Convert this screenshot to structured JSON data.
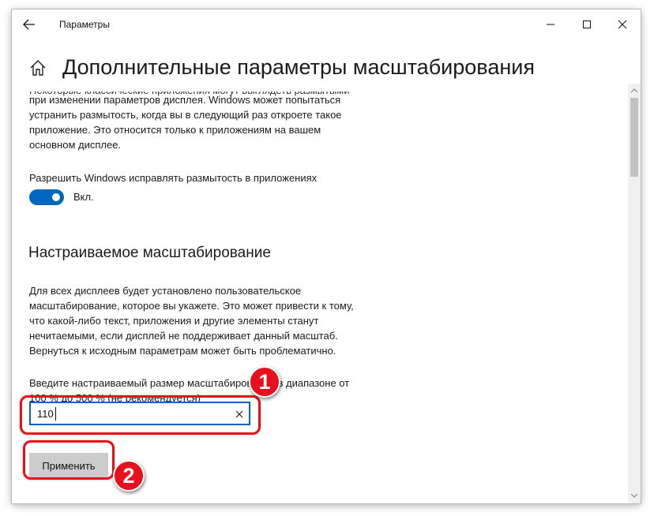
{
  "window": {
    "title": "Параметры",
    "back_icon": "arrow-left-icon",
    "controls": [
      "minimize-icon",
      "maximize-icon",
      "close-icon"
    ]
  },
  "page": {
    "home_icon": "home-icon",
    "title": "Дополнительные параметры масштабирования"
  },
  "blur_fix": {
    "intro_cut": "Некоторые классические приложения могут выглядеть размытыми",
    "intro_lines": [
      "при изменении параметров дисплея. Windows может попытаться",
      "устранить размытость, когда вы в следующий раз откроете такое",
      "приложение. Это относится только к приложениям на вашем",
      "основном дисплее."
    ],
    "setting_label": "Разрешить Windows исправлять размытость в приложениях",
    "toggle_state": "Вкл."
  },
  "custom_scaling": {
    "heading": "Настраиваемое масштабирование",
    "description_lines": [
      "Для всех дисплеев будет установлено пользовательское",
      "масштабирование, которое вы укажете. Это может привести к тому,",
      "что какой-либо текст, приложения и другие элементы станут",
      "нечитаемыми, если дисплей не поддерживает данный масштаб.",
      "Вернуться к исходным параметрам может быть проблематично."
    ],
    "input_label_lines": [
      "Введите настраиваемый размер масштабирования в диапазоне от",
      "100 % до 500 % (не рекомендуется)"
    ],
    "input_value": "110",
    "apply_label": "Применить"
  },
  "annotations": {
    "color": "#e8101b",
    "badges": [
      "1",
      "2"
    ]
  },
  "colors": {
    "accent": "#0067c0",
    "button_bg": "#cccccc"
  }
}
